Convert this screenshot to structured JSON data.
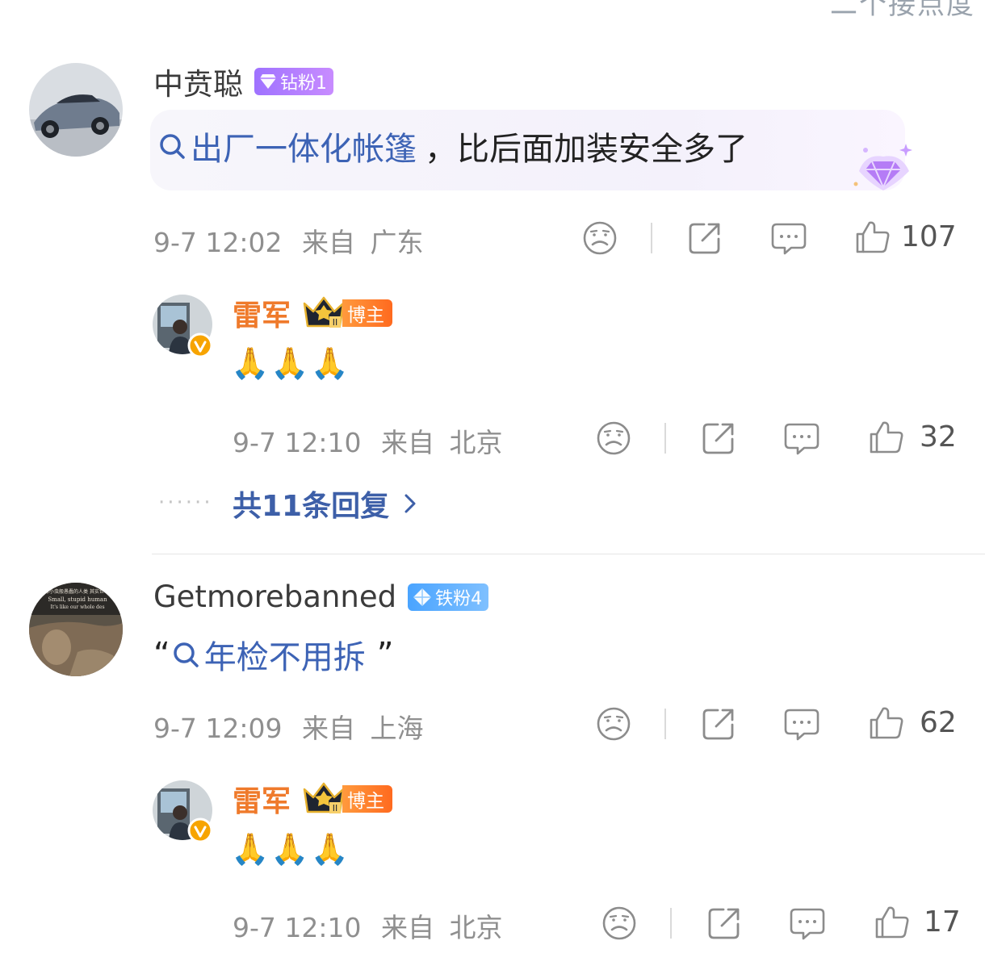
{
  "top_partial_text": "二个接点度",
  "comments": [
    {
      "user": "中贲聪",
      "badge": "钻粉1",
      "topic": "出厂一体化帐篷",
      "text_suffix": "，比后面加装安全多了",
      "time": "9-7 12:02",
      "from_label": "来自",
      "location": "广东",
      "likes": "107",
      "reply": {
        "user": "雷军",
        "crown_level": "II",
        "tag": "博主",
        "content": "🙏🙏🙏",
        "time": "9-7 12:10",
        "from_label": "来自",
        "location": "北京",
        "likes": "32"
      },
      "reply_count_text": "共11条回复"
    },
    {
      "user": "Getmorebanned",
      "badge": "铁粉4",
      "quote_open": "“",
      "topic": "年检不用拆",
      "quote_close": "”",
      "time": "9-7 12:09",
      "from_label": "来自",
      "location": "上海",
      "likes": "62",
      "avatar_text_1": "像小虫般愚蠢的人类 其实世",
      "avatar_text_2": "Small, stupid human",
      "avatar_text_3": "It's like our whole des",
      "reply": {
        "user": "雷军",
        "crown_level": "II",
        "tag": "博主",
        "content": "🙏🙏🙏",
        "time": "9-7 12:10",
        "from_label": "来自",
        "location": "北京",
        "likes": "17"
      }
    }
  ],
  "colors": {
    "topic_link": "#3d63b5",
    "reply_name": "#ef7a2b",
    "meta_gray": "#8f8f8f"
  },
  "icons": [
    "sad-face-icon",
    "share-icon",
    "comment-icon",
    "thumbs-up-icon",
    "search-icon",
    "verified-badge-icon",
    "crown-icon",
    "diamond-icon",
    "chevron-right-icon"
  ]
}
